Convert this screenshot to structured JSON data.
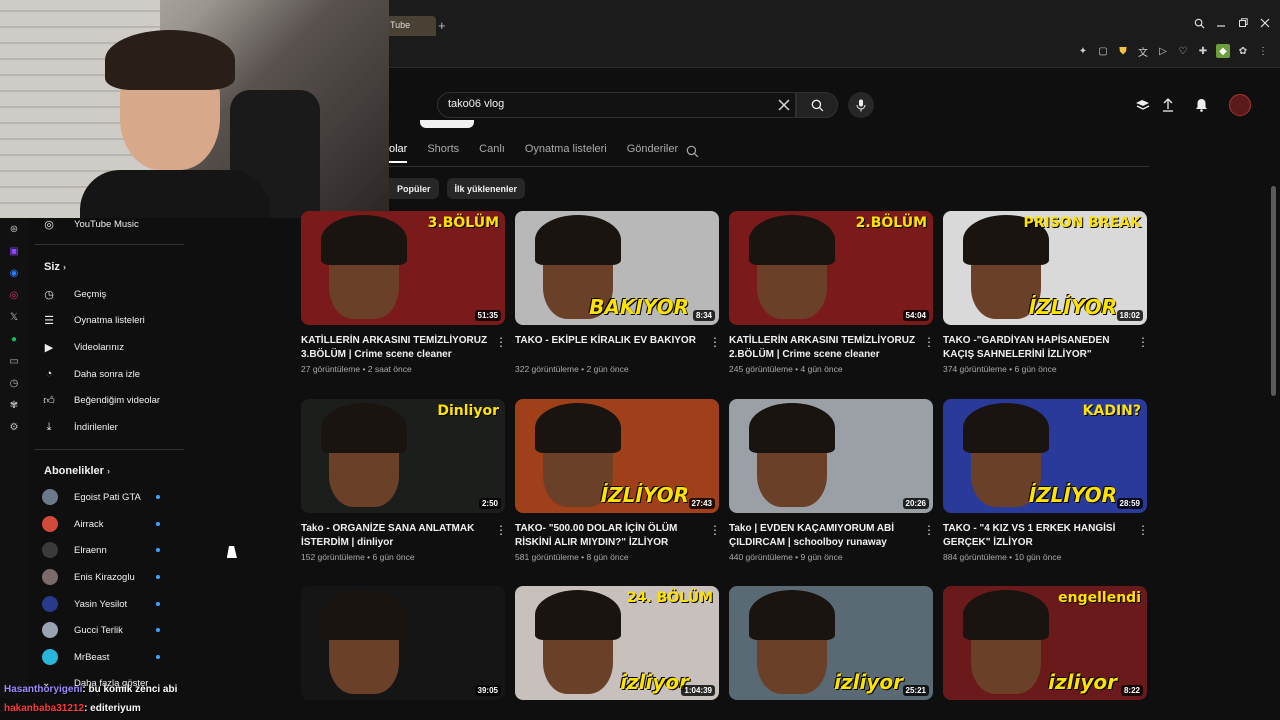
{
  "browser": {
    "tab_label": "Tube",
    "new_tab_glyph": "+",
    "window_controls": [
      "search-icon",
      "minimize-icon",
      "restore-icon",
      "close-icon"
    ],
    "extension_icons": [
      "pin-icon",
      "screenshot-icon",
      "shield-icon",
      "translate-icon",
      "play-icon",
      "heart-icon",
      "puzzle-icon",
      "extension-icon",
      "extension2-icon",
      "menu-icon"
    ],
    "side_icons": [
      "chatgpt-icon",
      "twitch-icon",
      "messenger-icon",
      "instagram-icon",
      "x-icon",
      "spotify-icon",
      "player-icon",
      "history-icon",
      "extensions-icon",
      "settings-icon"
    ]
  },
  "header": {
    "search_value": "tako06 vlog",
    "icons": [
      "create-icon",
      "upload-icon",
      "bell-icon"
    ]
  },
  "channel_tabs": {
    "items": [
      "olar",
      "Shorts",
      "Canlı",
      "Oynatma listeleri",
      "Gönderiler"
    ],
    "active_index": 0
  },
  "chips": [
    "Popüler",
    "İlk yüklenenler"
  ],
  "nav": {
    "music": "YouTube Music",
    "you_heading": "Siz",
    "you_items": [
      {
        "label": "Geçmiş",
        "icon": "history-icon"
      },
      {
        "label": "Oynatma listeleri",
        "icon": "playlist-icon"
      },
      {
        "label": "Videolarınız",
        "icon": "video-icon"
      },
      {
        "label": "Daha sonra izle",
        "icon": "clock-icon"
      },
      {
        "label": "Beğendiğim videolar",
        "icon": "like-icon"
      },
      {
        "label": "İndirilenler",
        "icon": "download-icon"
      }
    ],
    "subs_heading": "Abonelikler",
    "subs": [
      {
        "label": "Egoist Pati GTA",
        "color": "#6a7a8a"
      },
      {
        "label": "Airrack",
        "color": "#d24a3a"
      },
      {
        "label": "Elraenn",
        "color": "#3a3a3a"
      },
      {
        "label": "Enis Kirazoglu",
        "color": "#7a6a6a"
      },
      {
        "label": "Yasin Yesilot",
        "color": "#2a3a8a"
      },
      {
        "label": "Gucci Terlik",
        "color": "#9aa4b0"
      },
      {
        "label": "MrBeast",
        "color": "#29b6d8"
      }
    ],
    "show_more": "Daha fazla göster"
  },
  "videos": [
    {
      "title": "KATİLLERİN ARKASINI TEMİZLİYORUZ 3.BÖLÜM | Crime scene cleaner",
      "views": "27 görüntüleme",
      "age": "2 saat önce",
      "duration": "51:35",
      "bg": "#7a1a1a",
      "accent": "3.BÖLÜM",
      "overlay": ""
    },
    {
      "title": "TAKO - EKİPLE KİRALIK EV BAKIYOR",
      "views": "322 görüntüleme",
      "age": "2 gün önce",
      "duration": "8:34",
      "bg": "#b8b8b8",
      "accent": "",
      "overlay": "BAKIYOR"
    },
    {
      "title": "KATİLLERİN ARKASINI TEMİZLİYORUZ 2.BÖLÜM | Crime scene cleaner",
      "views": "245 görüntüleme",
      "age": "4 gün önce",
      "duration": "54:04",
      "bg": "#7a1a1a",
      "accent": "2.BÖLÜM",
      "overlay": ""
    },
    {
      "title": "TAKO -\"GARDİYAN HAPİSANEDEN KAÇIŞ SAHNELERİNİ İZLİYOR\" İZLİYOR",
      "views": "374 görüntüleme",
      "age": "6 gün önce",
      "duration": "18:02",
      "bg": "#d9d9d9",
      "accent": "PRISON BREAK",
      "overlay": "İZLİYOR"
    },
    {
      "title": "Tako - ORGANİZE SANA ANLATMAK İSTERDİM | dinliyor",
      "views": "152 görüntüleme",
      "age": "6 gün önce",
      "duration": "2:50",
      "bg": "#1c1e1c",
      "accent": "Dinliyor",
      "overlay": ""
    },
    {
      "title": "TAKO- \"500.00 DOLAR İÇİN ÖLÜM RİSKİNİ ALIR MIYDIN?\" İZLİYOR",
      "views": "581 görüntüleme",
      "age": "8 gün önce",
      "duration": "27:43",
      "bg": "#a0401a",
      "accent": "",
      "overlay": "İZLİYOR"
    },
    {
      "title": "Tako | EVDEN KAÇAMIYORUM ABİ ÇILDIRCAM | schoolboy runaway",
      "views": "440 görüntüleme",
      "age": "9 gün önce",
      "duration": "20:26",
      "bg": "#9aa0a6",
      "accent": "",
      "overlay": ""
    },
    {
      "title": "TAKO - \"4 KIZ VS 1 ERKEK HANGİSİ GERÇEK\" İZLİYOR",
      "views": "884 görüntüleme",
      "age": "10 gün önce",
      "duration": "28:59",
      "bg": "#2a3a9a",
      "accent": "KADIN?",
      "overlay": "İZLİYOR"
    },
    {
      "title": "",
      "views": "",
      "age": "",
      "duration": "39:05",
      "bg": "#151515",
      "accent": "",
      "overlay": ""
    },
    {
      "title": "",
      "views": "",
      "age": "",
      "duration": "1:04:39",
      "bg": "#c8c0bc",
      "accent": "24. BÖLÜM",
      "overlay": "izliyor"
    },
    {
      "title": "",
      "views": "",
      "age": "",
      "duration": "25:21",
      "bg": "#5a6a74",
      "accent": "",
      "overlay": "izliyor"
    },
    {
      "title": "",
      "views": "",
      "age": "",
      "duration": "8:22",
      "bg": "#6a1a1a",
      "accent": "engellendi",
      "overlay": "izliyor"
    }
  ],
  "chat": [
    {
      "user": "Hasanthoryigeni",
      "message": ": bu komik zenci abi"
    },
    {
      "user": "hakanbaba31212",
      "message": ": editeriyum"
    }
  ],
  "colors": {
    "background": "#0f0f0f",
    "accent_yellow": "#ffe300",
    "link_blue": "#3ea6ff"
  }
}
